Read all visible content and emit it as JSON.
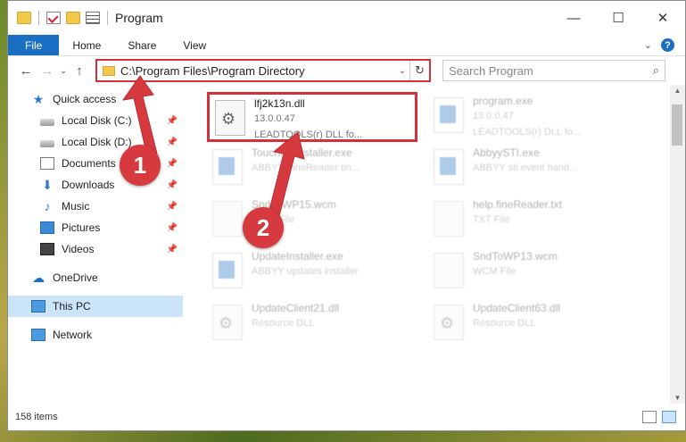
{
  "window": {
    "title": "Program",
    "controls": {
      "minimize": "—",
      "maximize": "☐",
      "close": "✕"
    }
  },
  "ribbon": {
    "tabs": [
      "File",
      "Home",
      "Share",
      "View"
    ],
    "help": "?"
  },
  "address": {
    "path": "C:\\Program Files\\Program Directory",
    "search_placeholder": "Search Program"
  },
  "sidebar": {
    "quick_access": "Quick access",
    "items": [
      {
        "label": "Local Disk (C:)",
        "icon": "disk-icon"
      },
      {
        "label": "Local Disk (D:)",
        "icon": "disk-icon"
      },
      {
        "label": "Documents",
        "icon": "documents-icon"
      },
      {
        "label": "Downloads",
        "icon": "downloads-icon"
      },
      {
        "label": "Music",
        "icon": "music-icon"
      },
      {
        "label": "Pictures",
        "icon": "pictures-icon"
      },
      {
        "label": "Videos",
        "icon": "videos-icon"
      }
    ],
    "onedrive": "OneDrive",
    "this_pc": "This PC",
    "network": "Network"
  },
  "files": [
    {
      "name": "lfj2k13n.dll",
      "line2": "13.0.0.47",
      "line3": "LEADTOOLS(r) DLL fo...",
      "icon": "dll-gear-icon"
    },
    {
      "name": "program.exe",
      "line2": "13.0.0.47",
      "line3": "LEADTOOLS(r) DLL fo...",
      "icon": "exe-icon"
    },
    {
      "name": "TouchmeInstaller.exe",
      "line2": "ABBYY FineReader tin...",
      "line3": "",
      "icon": "exe-icon"
    },
    {
      "name": "AbbyySTI.exe",
      "line2": "ABBYY sti event hand...",
      "line3": "",
      "icon": "exe-icon"
    },
    {
      "name": "SndToWP15.wcm",
      "line2": "WCM File",
      "line3": "",
      "icon": "file-icon"
    },
    {
      "name": "help.fineReader.txt",
      "line2": "TXT File",
      "line3": "",
      "icon": "file-icon"
    },
    {
      "name": "UpdateInstaller.exe",
      "line2": "ABBYY updates installer",
      "line3": "",
      "icon": "exe-icon"
    },
    {
      "name": "SndToWP13.wcm",
      "line2": "WCM File",
      "line3": "",
      "icon": "file-icon"
    },
    {
      "name": "UpdateClient21.dll",
      "line2": "Resource DLL",
      "line3": "",
      "icon": "dll-gear-icon"
    },
    {
      "name": "UpdateClient63.dll",
      "line2": "Resource DLL",
      "line3": "",
      "icon": "dll-gear-icon"
    }
  ],
  "status": {
    "items_count": "158 items"
  },
  "annotations": {
    "step1": "1",
    "step2": "2"
  },
  "colors": {
    "highlight": "#d3303a",
    "accent": "#1a6fc2",
    "badge": "#d63a3e"
  }
}
